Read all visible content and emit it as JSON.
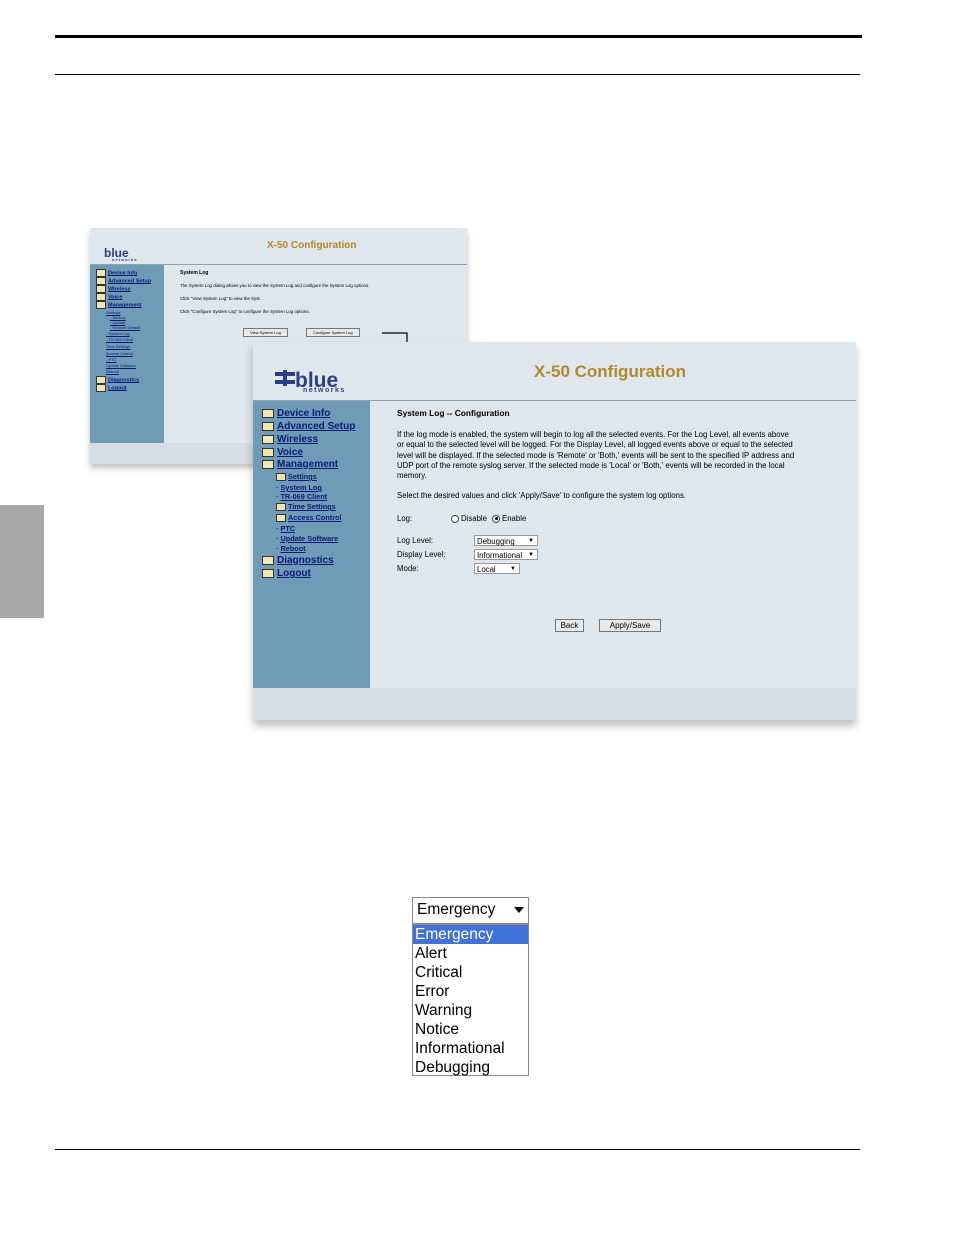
{
  "small_screenshot": {
    "logo": "blue",
    "logo_sub": "networks",
    "title": "X-50 Configuration",
    "nav": [
      {
        "label": "Device Info"
      },
      {
        "label": "Advanced Setup"
      },
      {
        "label": "Wireless"
      },
      {
        "label": "Voice"
      },
      {
        "label": "Management"
      }
    ],
    "nav_sub": [
      {
        "label": "Settings"
      },
      {
        "label": "- Backup"
      },
      {
        "label": "- Update"
      },
      {
        "label": "- Restore Default"
      },
      {
        "label": "- System Log"
      },
      {
        "label": "- TR-069 Client"
      },
      {
        "label": "Time Settings"
      },
      {
        "label": "Access Control"
      },
      {
        "label": "- PTC"
      },
      {
        "label": "Update Software"
      },
      {
        "label": "Reboot"
      }
    ],
    "nav_bottom": [
      {
        "label": "Diagnostics"
      },
      {
        "label": "Logout"
      }
    ],
    "heading": "System Log",
    "line1": "The System Log dialog allows you to view the System Log and configure the System Log options.",
    "line2": "Click \"View System Log\" to view the Syst.",
    "line3": "Click \"Configure System Log\" to configure the System Log options.",
    "btn_view": "View System Log",
    "btn_config": "Configure System Log"
  },
  "large_screenshot": {
    "logo": "blue",
    "logo_sub": "networks",
    "title": "X-50 Configuration",
    "nav": [
      {
        "label": "Device Info"
      },
      {
        "label": "Advanced Setup"
      },
      {
        "label": "Wireless"
      },
      {
        "label": "Voice"
      },
      {
        "label": "Management"
      }
    ],
    "nav_sub_settings": "Settings",
    "nav_sub_syslog": "System Log",
    "nav_sub_tr069": "TR-069 Client",
    "nav_sub_time": "Time Settings",
    "nav_sub_access": "Access Control",
    "nav_sub_ptc": "PTC",
    "nav_sub_update": "Update Software",
    "nav_sub_reboot": "Reboot",
    "nav_diagnostics": "Diagnostics",
    "nav_logout": "Logout",
    "heading": "System Log -- Configuration",
    "para1_l1": "If the log mode is enabled, the system will begin to log all the selected events. For the Log Level, all events above",
    "para1_l2": "or equal to the selected level will be logged. For the Display Level, all logged events above or equal to the selected",
    "para1_l3": "level will be displayed. If the selected mode is 'Remote' or 'Both,' events will be sent to the specified IP address and",
    "para1_l4": "UDP port of the remote syslog server. If the selected mode is 'Local' or 'Both,' events will be recorded in the local",
    "para1_l5": "memory.",
    "para2": "Select the desired values and click 'Apply/Save' to configure the system log options.",
    "log_label": "Log:",
    "disable_label": "Disable",
    "enable_label": "Enable",
    "log_level_label": "Log Level:",
    "log_level_value": "Debugging",
    "display_level_label": "Display Level:",
    "display_level_value": "Informational",
    "mode_label": "Mode:",
    "mode_value": "Local",
    "back_button": "Back",
    "apply_button": "Apply/Save"
  },
  "dropdown": {
    "selected": "Emergency",
    "options": [
      "Emergency",
      "Alert",
      "Critical",
      "Error",
      "Warning",
      "Notice",
      "Informational",
      "Debugging"
    ],
    "highlight_color": "#3f73d9"
  }
}
